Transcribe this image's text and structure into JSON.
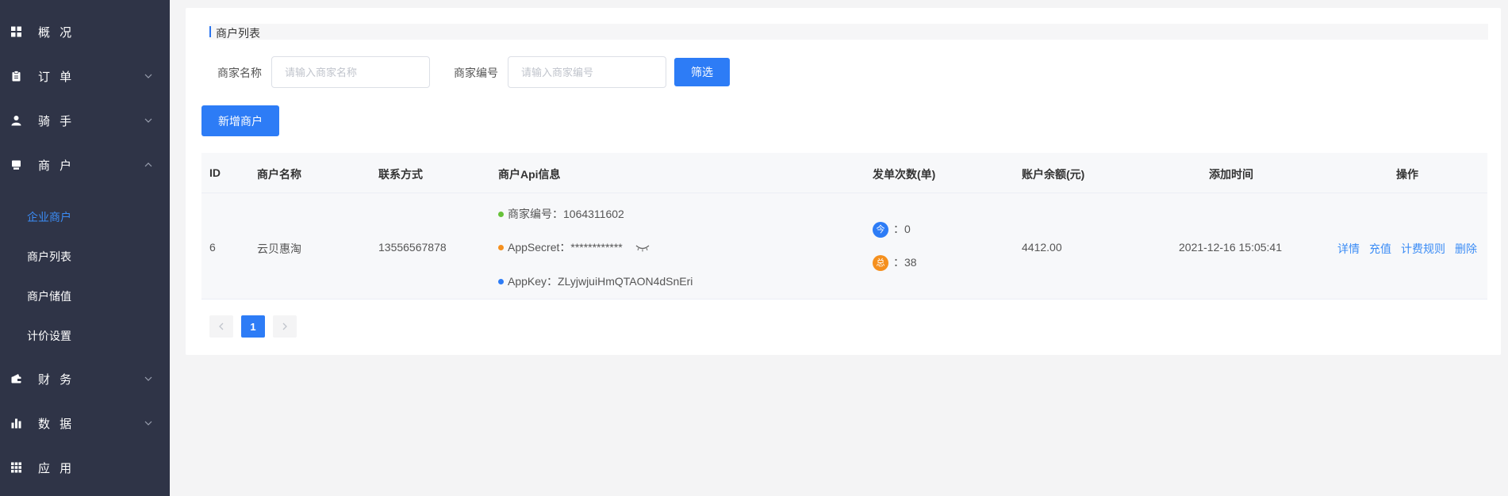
{
  "sidebar": {
    "items": [
      {
        "label": "概 况",
        "icon": "grid-icon"
      },
      {
        "label": "订 单",
        "icon": "clipboard-icon"
      },
      {
        "label": "骑 手",
        "icon": "user-icon"
      },
      {
        "label": "商 户",
        "icon": "store-icon"
      },
      {
        "label": "财 务",
        "icon": "wallet-icon"
      },
      {
        "label": "数 据",
        "icon": "bar-chart-icon"
      },
      {
        "label": "应 用",
        "icon": "apps-icon"
      }
    ],
    "merchant_sub": [
      "企业商户",
      "商户列表",
      "商户储值",
      "计价设置"
    ]
  },
  "section_title": "商户列表",
  "filters": {
    "name_label": "商家名称",
    "name_placeholder": "请输入商家名称",
    "code_label": "商家编号",
    "code_placeholder": "请输入商家编号",
    "filter_button": "筛选"
  },
  "add_button": "新增商户",
  "table": {
    "headers": [
      "ID",
      "商户名称",
      "联系方式",
      "商户Api信息",
      "发单次数(单)",
      "账户余额(元)",
      "添加时间",
      "操作"
    ],
    "rows": [
      {
        "id": "6",
        "name": "云贝惠淘",
        "phone": "13556567878",
        "api_code": "商家编号：1064311602",
        "api_secret": "AppSecret：************",
        "api_key": "AppKey：ZLyjwjuiHmQTAON4dSnEri",
        "today_badge": "今",
        "today_count": "：0",
        "total_badge": "总",
        "total_count": "：38",
        "balance": "4412.00",
        "created": "2021-12-16 15:05:41",
        "ops": [
          "详情",
          "充值",
          "计费规则",
          "删除"
        ]
      }
    ]
  },
  "pagination": {
    "current": "1"
  },
  "colors": {
    "sidebar_bg": "#2f3447",
    "accent": "#2d7cf6",
    "link": "#3b8cf5",
    "dot_green": "#67c23a",
    "dot_orange": "#f5901e",
    "dot_blue": "#2d7cf6",
    "badge_today": "#2d7cf6",
    "badge_total": "#f5901e"
  }
}
